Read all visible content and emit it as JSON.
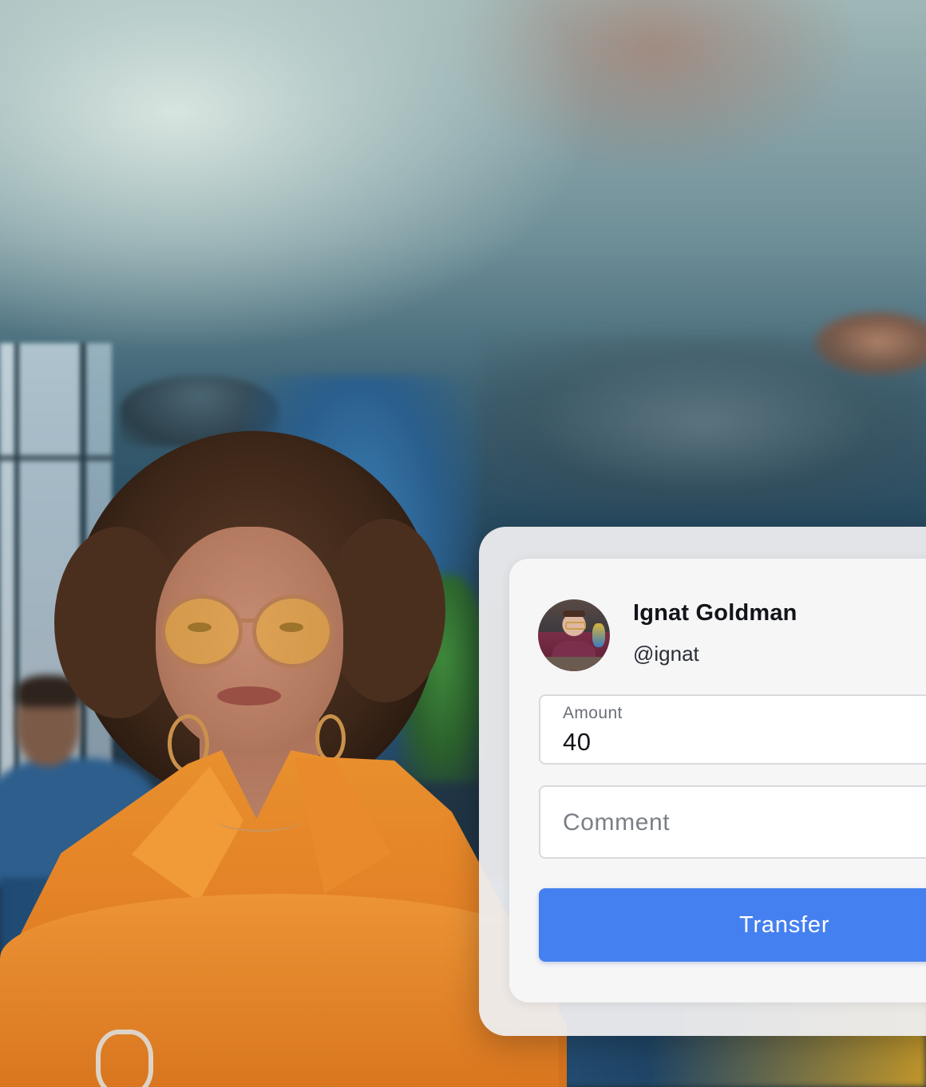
{
  "transfer_card": {
    "recipient": {
      "name": "Ignat Goldman",
      "handle": "@ignat"
    },
    "amount": {
      "label": "Amount",
      "value": "40"
    },
    "comment": {
      "placeholder": "Comment",
      "value": ""
    },
    "submit_label": "Transfer",
    "accent_color": "#4580f0"
  }
}
